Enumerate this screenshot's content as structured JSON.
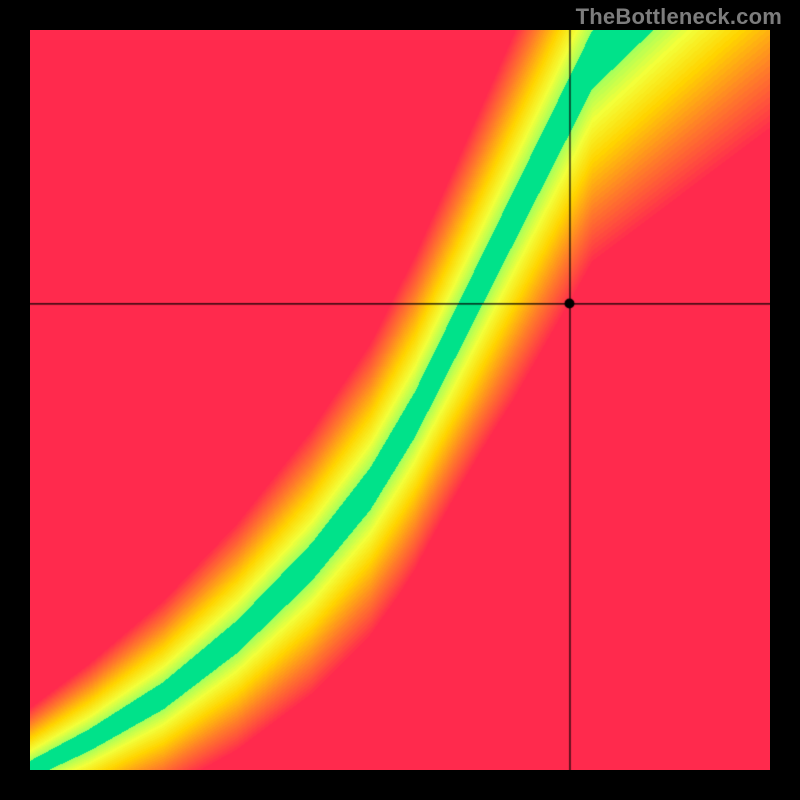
{
  "watermark": "TheBottleneck.com",
  "chart_data": {
    "type": "heatmap",
    "title": "",
    "xlabel": "",
    "ylabel": "",
    "xlim": [
      0,
      1
    ],
    "ylim": [
      0,
      1
    ],
    "crosshair": {
      "x": 0.73,
      "y": 0.63
    },
    "marker": {
      "x": 0.73,
      "y": 0.63
    },
    "color_stops": [
      {
        "t": 0.0,
        "hex": "#ff2a4d"
      },
      {
        "t": 0.25,
        "hex": "#ff7a2a"
      },
      {
        "t": 0.5,
        "hex": "#ffd400"
      },
      {
        "t": 0.7,
        "hex": "#f3ff3a"
      },
      {
        "t": 0.85,
        "hex": "#a8ff5a"
      },
      {
        "t": 1.0,
        "hex": "#00e28a"
      }
    ],
    "optimal_curve": [
      {
        "x": 0.0,
        "y": 0.0
      },
      {
        "x": 0.08,
        "y": 0.04
      },
      {
        "x": 0.18,
        "y": 0.1
      },
      {
        "x": 0.28,
        "y": 0.18
      },
      {
        "x": 0.38,
        "y": 0.28
      },
      {
        "x": 0.46,
        "y": 0.38
      },
      {
        "x": 0.52,
        "y": 0.48
      },
      {
        "x": 0.58,
        "y": 0.6
      },
      {
        "x": 0.64,
        "y": 0.72
      },
      {
        "x": 0.7,
        "y": 0.84
      },
      {
        "x": 0.76,
        "y": 0.96
      },
      {
        "x": 0.8,
        "y": 1.0
      }
    ],
    "ridge_width": 0.06,
    "edge_falloff": 0.08,
    "description": "2D heatmap where green band marks balanced pairing along the curved ridge; crosshair/marker shows selected point slightly right of the green band at roughly (0.73, 0.63), landing in the yellow/orange transition zone."
  }
}
